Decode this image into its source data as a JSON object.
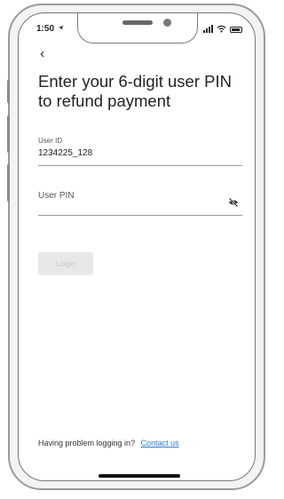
{
  "status_bar": {
    "time": "1:50"
  },
  "nav": {
    "back_glyph": "‹"
  },
  "page": {
    "title": "Enter your 6-digit user PIN to refund payment"
  },
  "user_id": {
    "label": "User ID",
    "value": "1234225_128"
  },
  "user_pin": {
    "placeholder": "User PIN",
    "visibility_icon": "eye-off-icon"
  },
  "login_button": {
    "label": "Login"
  },
  "footer": {
    "prompt": "Having problem logging in?",
    "link": "Contact us"
  },
  "colors": {
    "link": "#2b7bd6",
    "disabled_button_bg": "#e8e8e8",
    "disabled_button_text": "#c8c8c8"
  }
}
